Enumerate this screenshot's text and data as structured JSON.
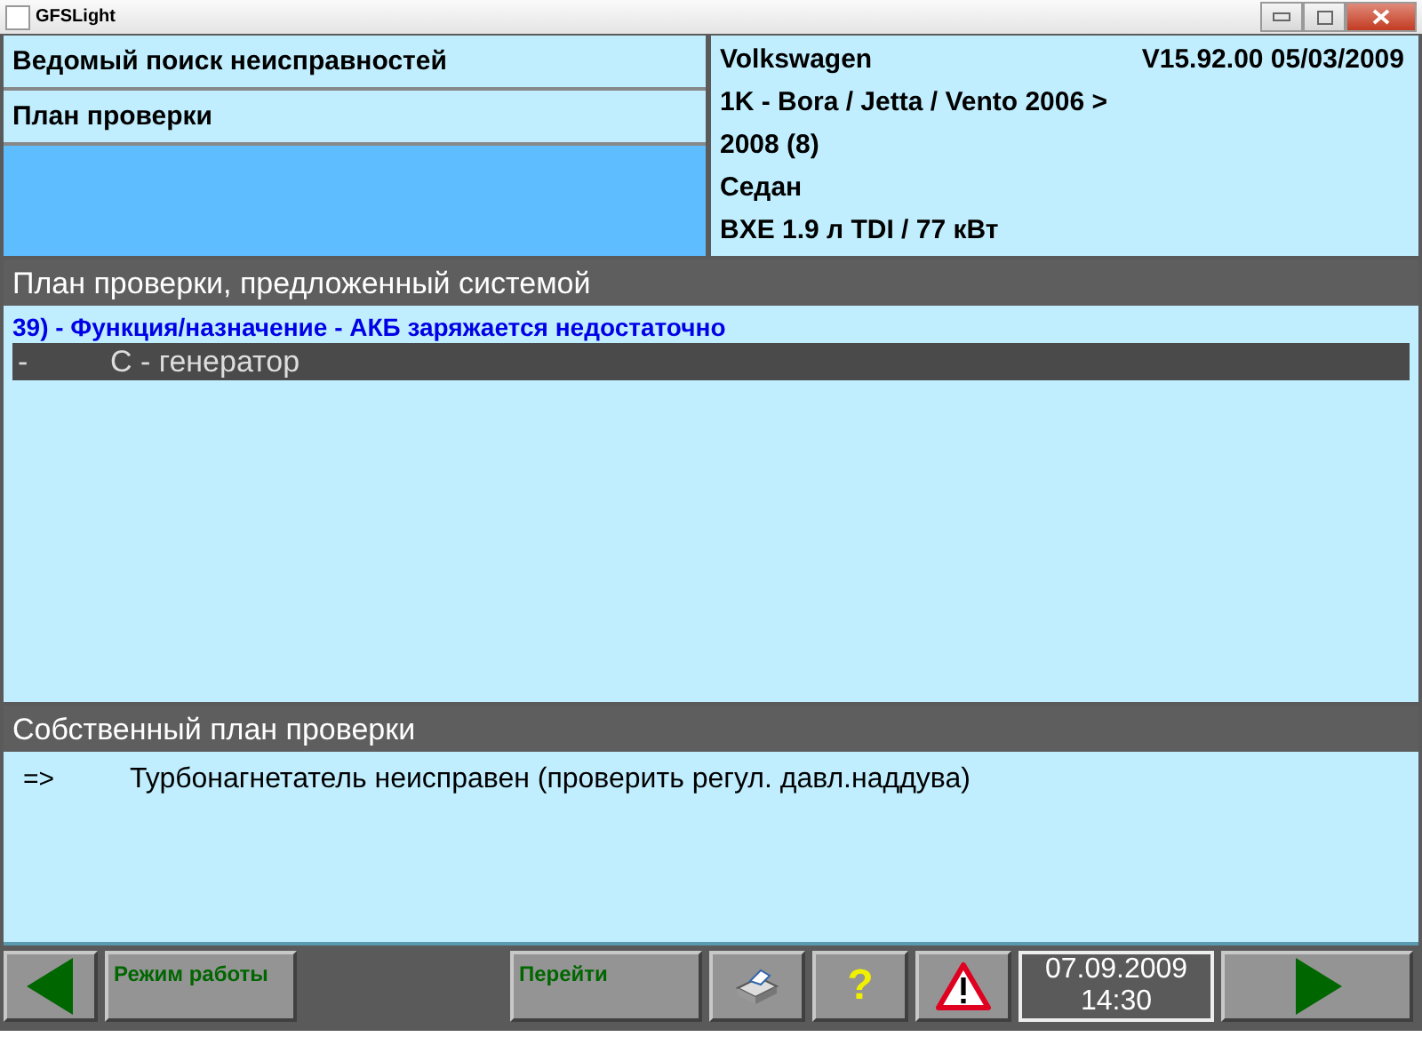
{
  "window": {
    "title": "GFSLight"
  },
  "header": {
    "left": [
      {
        "text": "Ведомый поиск неисправностей"
      },
      {
        "text": "План проверки"
      }
    ],
    "vehicle": {
      "make": "Volkswagen",
      "version": "V15.92.00 05/03/2009",
      "lines": [
        "1K - Bora / Jetta / Vento 2006 >",
        "2008 (8)",
        "Седан",
        "BXE 1.9 л TDI / 77 кВт"
      ]
    }
  },
  "system_plan": {
    "title": "План проверки, предложенный системой",
    "items": [
      {
        "kind": "group",
        "text": "39) - Функция/назначение - АКБ заряжается недостаточно",
        "selected": false
      },
      {
        "kind": "step",
        "marker": "-",
        "text": "C - генератор",
        "selected": true
      }
    ]
  },
  "own_plan": {
    "title": "Собственный план проверки",
    "items": [
      {
        "marker": "=>",
        "text": "Турбонагнетатель неисправен (проверить регул. давл.наддува)",
        "selected": false
      }
    ]
  },
  "toolbar": [
    {
      "kind": "back"
    },
    {
      "kind": "label",
      "text": "Режим работы"
    },
    {
      "kind": "spacer"
    },
    {
      "kind": "label",
      "text": "Перейти"
    },
    {
      "kind": "print"
    },
    {
      "kind": "help",
      "text": "?"
    },
    {
      "kind": "warning"
    },
    {
      "kind": "clock",
      "date": "07.09.2009",
      "time": "14:30"
    },
    {
      "kind": "forward"
    }
  ]
}
